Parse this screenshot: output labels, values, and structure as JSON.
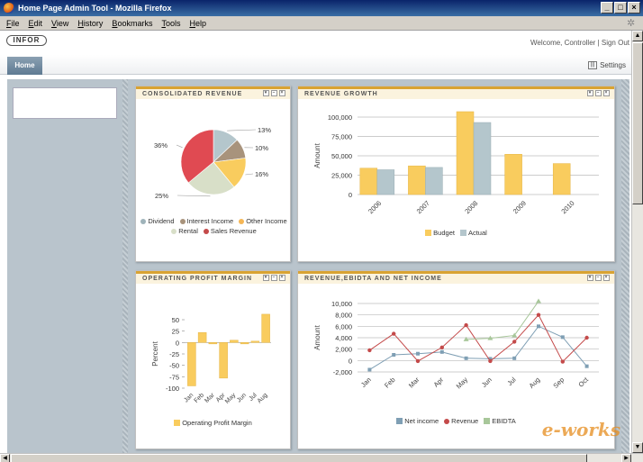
{
  "window": {
    "title": "Home Page Admin Tool - Mozilla Firefox"
  },
  "menu": [
    "File",
    "Edit",
    "View",
    "History",
    "Bookmarks",
    "Tools",
    "Help"
  ],
  "header": {
    "logo": "INFOR",
    "welcome": "Welcome, Controller",
    "separator": "|",
    "sign_out": "Sign Out"
  },
  "nav": {
    "home_tab": "Home",
    "settings": "Settings"
  },
  "panels": {
    "consolidated_revenue": "CONSOLIDATED REVENUE",
    "revenue_growth": "REVENUE GROWTH",
    "operating_profit": "OPERATING PROFIT MARGIN",
    "revenue_ebidta": "REVENUE,EBIDTA AND NET INCOME"
  },
  "watermark": "e-works",
  "colors": {
    "budget": "#f9cc5e",
    "actual": "#b4c6cc",
    "netincome": "#7f9fb4",
    "revenue": "#c44a4a",
    "ebidta": "#a8c79a",
    "header_accent": "#d9a332"
  },
  "chart_data": [
    {
      "type": "pie",
      "title": "CONSOLIDATED REVENUE",
      "slices": [
        {
          "name": "Dividend",
          "value": 13,
          "label": "13%",
          "color": "#b4c6cc"
        },
        {
          "name": "Interest Income",
          "value": 10,
          "label": "10%",
          "color": "#a8937c"
        },
        {
          "name": "Other Income",
          "value": 16,
          "label": "16%",
          "color": "#f9cc5e"
        },
        {
          "name": "Rental",
          "value": 25,
          "label": "25%",
          "color": "#d8dfc8"
        },
        {
          "name": "Sales Revenue",
          "value": 36,
          "label": "36%",
          "color": "#e04a52"
        }
      ],
      "legend": [
        "Dividend",
        "Interest Income",
        "Other Income",
        "Rental",
        "Sales Revenue"
      ],
      "legend_colors": [
        "#9fb3ba",
        "#a8937c",
        "#f5b655",
        "#d8dfc8",
        "#c44a4a"
      ]
    },
    {
      "type": "bar",
      "title": "REVENUE GROWTH",
      "categories": [
        "2006",
        "2007",
        "2008",
        "2009",
        "2010"
      ],
      "series": [
        {
          "name": "Budget",
          "values": [
            34000,
            37000,
            107000,
            52000,
            40000
          ],
          "color": "#f9cc5e"
        },
        {
          "name": "Actual",
          "values": [
            32000,
            35000,
            93000,
            null,
            null
          ],
          "color": "#b4c6cc"
        }
      ],
      "ylabel": "Amount",
      "ylim": [
        0,
        100000
      ],
      "yticks": [
        0,
        25000,
        50000,
        75000,
        100000
      ],
      "ytick_labels": [
        "0",
        "25,000",
        "50,000",
        "75,000",
        "100,000"
      ]
    },
    {
      "type": "bar",
      "title": "OPERATING PROFIT MARGIN",
      "categories": [
        "Jan",
        "Feb",
        "Mar",
        "Apr",
        "May",
        "Jun",
        "Jul",
        "Aug"
      ],
      "series": [
        {
          "name": "Operating Profit Margin",
          "values": [
            -95,
            22,
            -3,
            -78,
            5,
            -3,
            3,
            62
          ],
          "color": "#f9cc5e"
        }
      ],
      "ylabel": "Percent",
      "ylim": [
        -100,
        50
      ],
      "yticks": [
        -100,
        -75,
        -50,
        -25,
        0,
        25,
        50
      ],
      "ytick_labels": [
        "-100",
        "-75",
        "-50",
        "-25",
        "0",
        "25",
        "50"
      ]
    },
    {
      "type": "line",
      "title": "REVENUE,EBIDTA AND NET INCOME",
      "categories": [
        "Jan",
        "Feb",
        "Mar",
        "Apr",
        "May",
        "Jun",
        "Jul",
        "Aug",
        "Sep",
        "Oct"
      ],
      "series": [
        {
          "name": "Net income",
          "values": [
            -1600,
            1000,
            1200,
            1500,
            400,
            300,
            400,
            6000,
            4100,
            -1000
          ],
          "color": "#7f9fb4",
          "marker": "square"
        },
        {
          "name": "Revenue",
          "values": [
            1800,
            4700,
            -100,
            2300,
            6200,
            -100,
            3300,
            8000,
            -200,
            4000
          ],
          "color": "#c44a4a",
          "marker": "circle"
        },
        {
          "name": "EBIDTA",
          "values": [
            null,
            null,
            null,
            null,
            3700,
            3900,
            4400,
            10400,
            null,
            null
          ],
          "color": "#a8c79a",
          "marker": "triangle"
        }
      ],
      "ylabel": "Amount",
      "ylim": [
        -2000,
        10000
      ],
      "yticks": [
        -2000,
        0,
        2000,
        4000,
        6000,
        8000,
        10000
      ],
      "ytick_labels": [
        "-2,000",
        "0",
        "2,000",
        "4,000",
        "6,000",
        "8,000",
        "10,000"
      ]
    }
  ]
}
